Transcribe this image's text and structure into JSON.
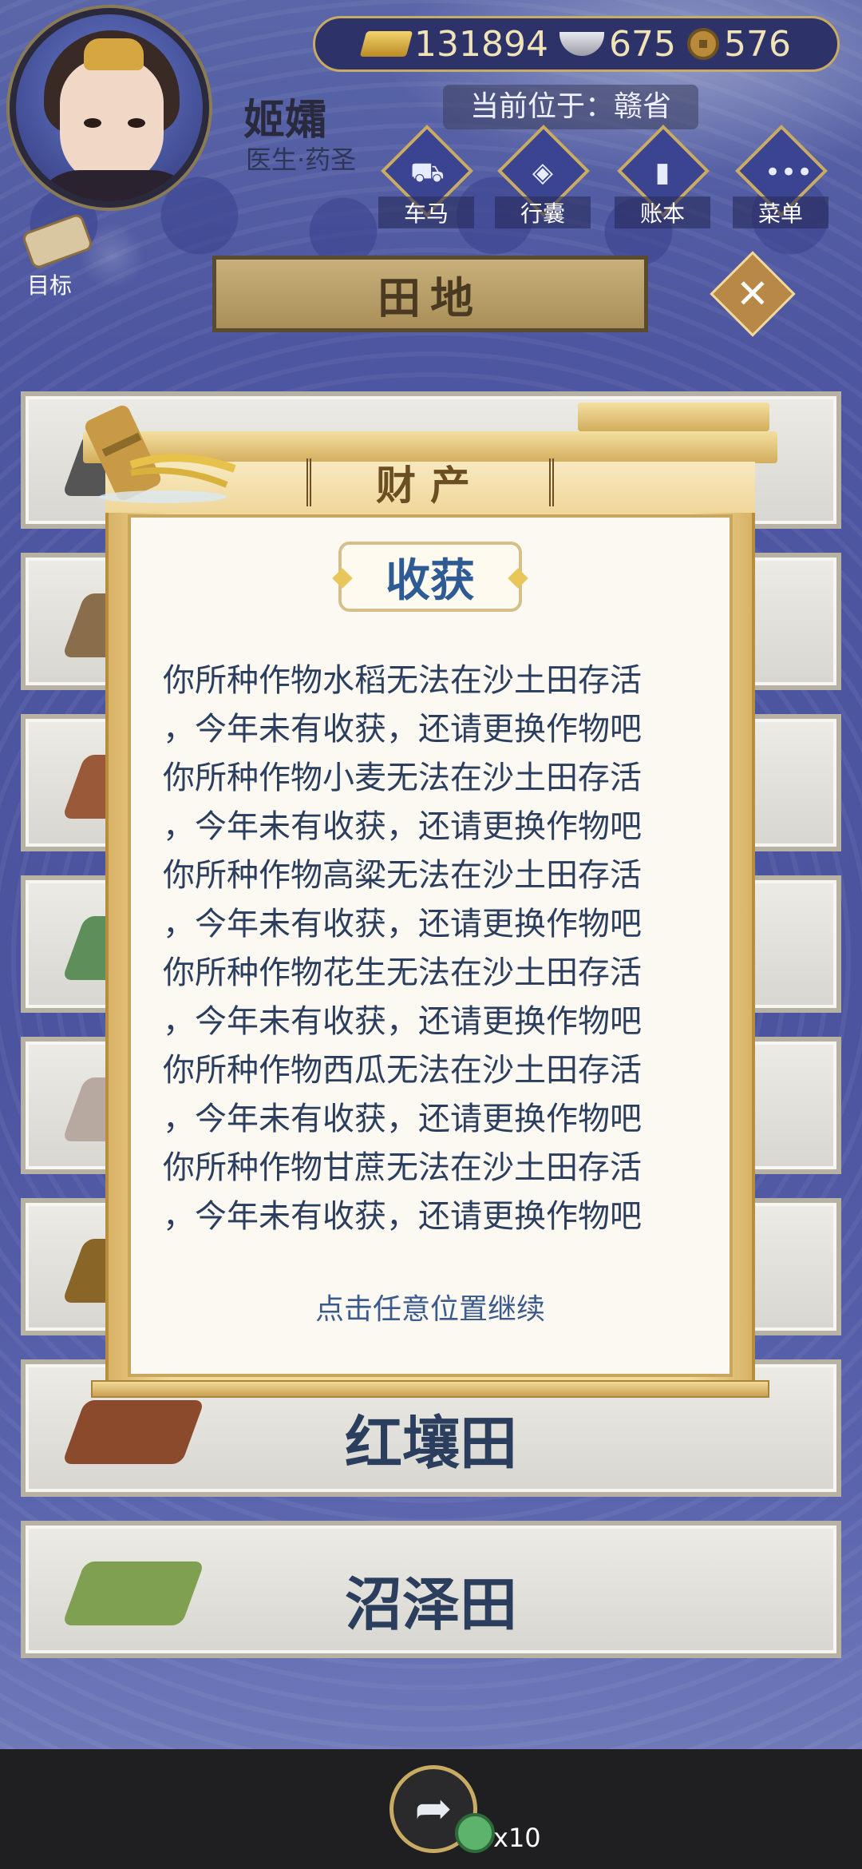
{
  "player": {
    "name": "姬孀",
    "title": "医生·药圣"
  },
  "currency": {
    "gold": "131894",
    "silver": "675",
    "copper": "576"
  },
  "location": "当前位于：赣省",
  "hud": {
    "items": [
      {
        "label": "车马",
        "icon": "carriage-icon"
      },
      {
        "label": "行囊",
        "icon": "bag-icon"
      },
      {
        "label": "账本",
        "icon": "ledger-icon"
      },
      {
        "label": "菜单",
        "icon": "menu-icon"
      }
    ],
    "goal_label": "目标"
  },
  "panel_tab": "田地",
  "lands": [
    {
      "name": "",
      "thumb_color": "#555"
    },
    {
      "name": "",
      "thumb_color": "#8a6d4a"
    },
    {
      "name": "",
      "thumb_color": "#9a5a3a"
    },
    {
      "name": "",
      "thumb_color": "#5e8f5a"
    },
    {
      "name": "",
      "thumb_color": "#b8a9a0"
    },
    {
      "name": "",
      "thumb_color": "#8a6528"
    },
    {
      "name": "红壤田",
      "thumb_color": "#8b4a2c"
    },
    {
      "name": "沼泽田",
      "thumb_color": "#7fa050"
    }
  ],
  "modal": {
    "section_title": "财产",
    "title": "收获",
    "lines": [
      "你所种作物水稻无法在沙土田存活",
      "，今年未有收获，还请更换作物吧",
      "你所种作物小麦无法在沙土田存活",
      "，今年未有收获，还请更换作物吧",
      "你所种作物高粱无法在沙土田存活",
      "，今年未有收获，还请更换作物吧",
      "你所种作物花生无法在沙土田存活",
      "，今年未有收获，还请更换作物吧",
      "你所种作物西瓜无法在沙土田存活",
      "，今年未有收获，还请更换作物吧",
      "你所种作物甘蔗无法在沙土田存活",
      "，今年未有收获，还请更换作物吧"
    ],
    "continue_hint": "点击任意位置继续"
  },
  "bottom": {
    "share_reward": "x10"
  },
  "colors": {
    "accent_gold": "#c9ab63",
    "text_blue": "#2e5b93",
    "bg_blue": "#4a5298"
  }
}
